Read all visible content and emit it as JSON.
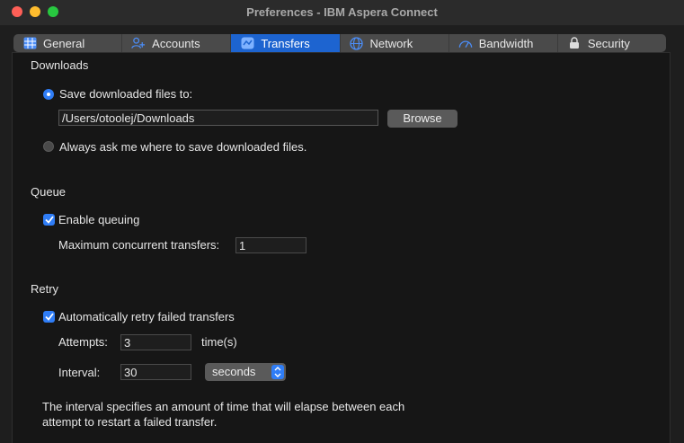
{
  "window": {
    "title": "Preferences - IBM Aspera Connect"
  },
  "tabs": [
    {
      "label": "General",
      "icon": "grid-icon",
      "active": false
    },
    {
      "label": "Accounts",
      "icon": "users-icon",
      "active": false
    },
    {
      "label": "Transfers",
      "icon": "transfers-icon",
      "active": true
    },
    {
      "label": "Network",
      "icon": "globe-icon",
      "active": false
    },
    {
      "label": "Bandwidth",
      "icon": "gauge-icon",
      "active": false
    },
    {
      "label": "Security",
      "icon": "lock-icon",
      "active": false
    }
  ],
  "downloads": {
    "title": "Downloads",
    "save_to_label": "Save downloaded files to:",
    "path_value": "/Users/otoolej/Downloads",
    "browse_label": "Browse",
    "always_ask_label": "Always ask me where to save downloaded files.",
    "selected": "save_to"
  },
  "queue": {
    "title": "Queue",
    "enable_label": "Enable queuing",
    "enable_checked": true,
    "max_label": "Maximum concurrent transfers:",
    "max_value": "1"
  },
  "retry": {
    "title": "Retry",
    "auto_label": "Automatically retry failed transfers",
    "auto_checked": true,
    "attempts_label": "Attempts:",
    "attempts_value": "3",
    "attempts_unit": "time(s)",
    "interval_label": "Interval:",
    "interval_value": "30",
    "interval_unit": "seconds",
    "note": "The interval specifies an amount of time that will elapse between each attempt to restart a failed transfer."
  },
  "colors": {
    "accent": "#2f7df6",
    "active_tab": "#1d64d0",
    "close": "#fe5f57",
    "minimize": "#febc2e",
    "zoom": "#28c840"
  }
}
